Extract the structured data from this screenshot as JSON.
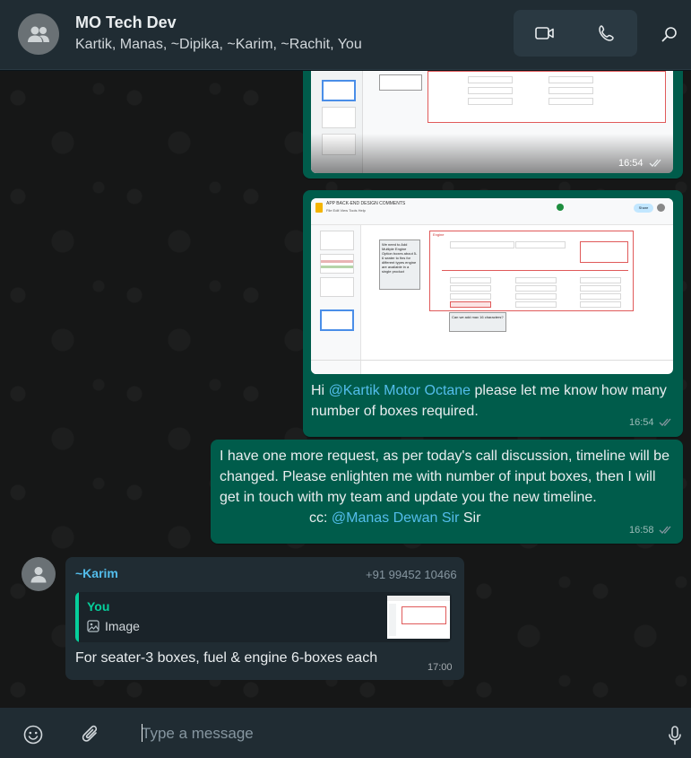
{
  "header": {
    "title": "MO Tech Dev",
    "members": "Kartik, Manas, ~Dipika, ~Karim, ~Rachit, You"
  },
  "messages": [
    {
      "type": "image",
      "direction": "out",
      "time": "16:54",
      "status": "read"
    },
    {
      "type": "image",
      "direction": "out",
      "image_text": {
        "doc_title": "APP BACK-END DESIGN COMMENTS",
        "menu": "File  Edit  View  Tools  Help",
        "section": "Engine",
        "comment1": "We need to Add Multiple Engine Option boxes about 5-6 seater to fins for different types engine are available in a single product",
        "comment2": "Can we add max 16 characters?",
        "share": "Share"
      },
      "text_before": "Hi ",
      "mention": "@Kartik Motor Octane",
      "text_after": "  please let me know how many number of boxes required.",
      "time": "16:54",
      "status": "read"
    },
    {
      "type": "text",
      "direction": "out",
      "text": "I have one more request, as per today's call discussion, timeline will be changed. Please enlighten me with number of input boxes, then I will get in touch with my team and update you the new timeline.",
      "cc_label": "cc: ",
      "mention": "@Manas Dewan Sir",
      "text_after": "  Sir",
      "time": "16:58",
      "status": "read"
    },
    {
      "type": "text",
      "direction": "in",
      "sender": "~Karim",
      "phone": "+91 99452 10466",
      "quote": {
        "author": "You",
        "label": "Image"
      },
      "text": "For seater-3 boxes, fuel & engine 6-boxes each",
      "time": "17:00"
    }
  ],
  "composer": {
    "placeholder": "Type a message"
  },
  "colors": {
    "outgoing_bubble": "#005c4b",
    "incoming_bubble": "#202c33",
    "mention": "#53bdeb",
    "sender_name": "#53bdeb",
    "quote_accent": "#06cf9c"
  }
}
